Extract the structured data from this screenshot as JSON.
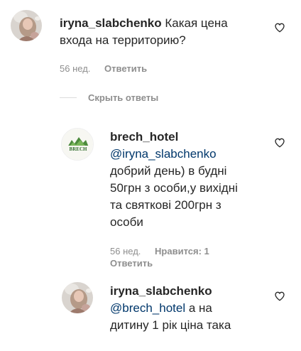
{
  "comments": [
    {
      "username": "iryna_slabchenko",
      "text": "Какая цена входа на территорию?",
      "time": "56 нед.",
      "reply_label": "Ответить"
    }
  ],
  "replies_toggle": "Скрыть ответы",
  "replies": [
    {
      "username": "brech_hotel",
      "mention": "@iryna_slabchenko",
      "text_lines": [
        "добрий день) в будні",
        "50грн з особи,у вихідні",
        "та святкові 200грн з",
        "особи"
      ],
      "time": "56 нед.",
      "likes_label": "Нравится: 1",
      "reply_label": "Ответить",
      "avatar_logo": "BRECH"
    },
    {
      "username": "iryna_slabchenko",
      "mention": "@brech_hotel",
      "text_after_mention": "а на",
      "text_line2": "дитину 1 рік ціна така"
    }
  ],
  "colors": {
    "text": "#262626",
    "secondary": "#8e8e8e",
    "mention": "#00376b",
    "divider": "#dbdbdb"
  },
  "icons": {
    "like": "heart-outline-icon",
    "avatar_user": "user-photo",
    "avatar_hotel": "hotel-logo"
  }
}
